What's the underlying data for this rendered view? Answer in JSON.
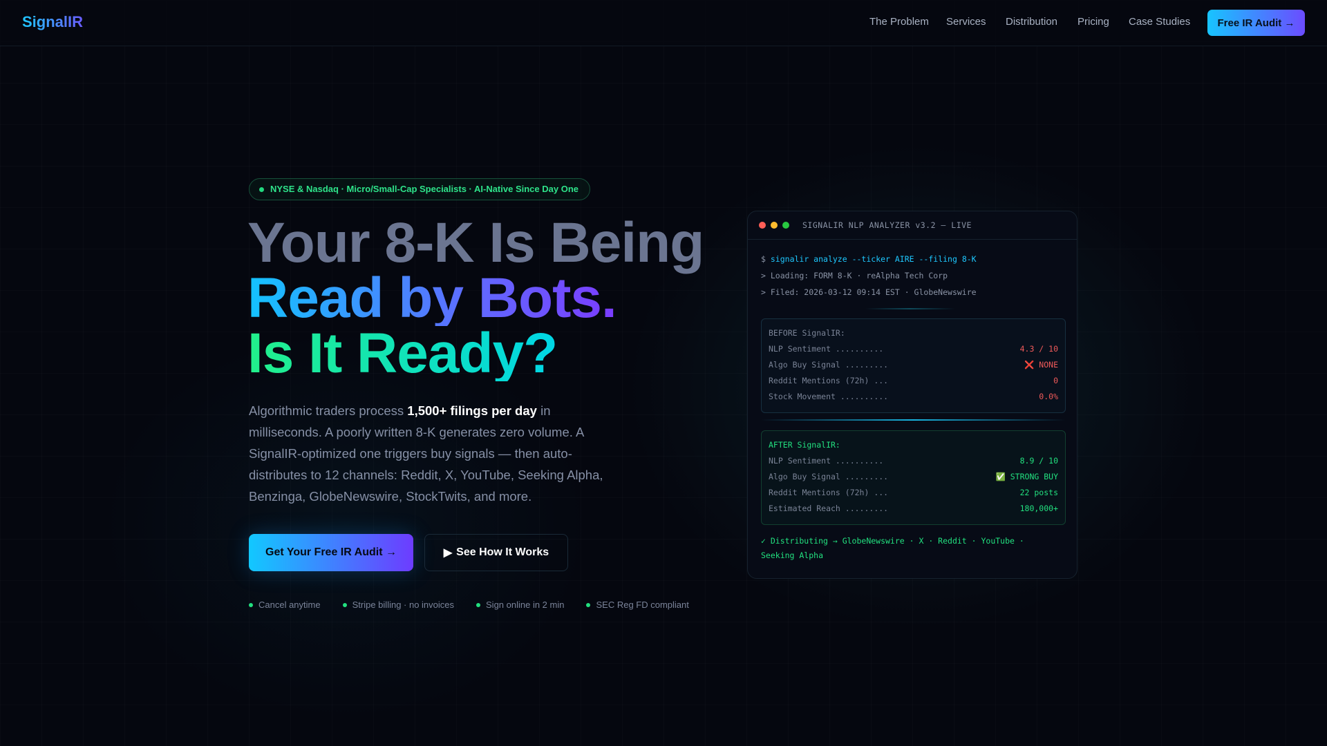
{
  "nav": {
    "logo": "SignalIR",
    "links": [
      "The Problem",
      "Services",
      "Distribution",
      "Pricing",
      "Case Studies"
    ],
    "cta": "Free IR Audit →"
  },
  "hero": {
    "badge": "NYSE & Nasdaq · Micro/Small-Cap Specialists · AI-Native Since Day One",
    "headline": [
      "Your 8-K Is Being",
      "Read by Bots.",
      "Is It Ready?"
    ],
    "para_pre": "Algorithmic traders process ",
    "para_bold": "1,500+ filings per day",
    "para_post": " in milliseconds. A poorly written 8-K generates zero volume. A SignalIR-optimized one triggers buy signals — then auto-distributes to 12 channels: Reddit, X, YouTube, Seeking Alpha, Benzinga, GlobeNewswire, StockTwits, and more.",
    "primary_cta": "Get Your Free IR Audit →",
    "secondary_cta": "See How It Works",
    "trust": [
      "Cancel anytime",
      "Stripe billing · no invoices",
      "Sign online in 2 min",
      "SEC Reg FD compliant"
    ]
  },
  "terminal": {
    "title": "SIGNALIR NLP ANALYZER v3.2 — LIVE",
    "prompt": "$",
    "command": "signalir analyze --ticker AIRE --filing 8-K",
    "lines": [
      "> Loading: FORM 8-K · reAlpha Tech Corp",
      "> Filed: 2026-03-12 09:14 EST · GlobeNewswire"
    ],
    "before": {
      "heading": "BEFORE SignalIR:",
      "rows": [
        {
          "label": "NLP Sentiment ..........",
          "value": "4.3 / 10"
        },
        {
          "label": "Algo Buy Signal .........",
          "value": "❌ NONE"
        },
        {
          "label": "Reddit Mentions (72h) ...",
          "value": "0"
        },
        {
          "label": "Stock Movement ..........",
          "value": "0.0%"
        }
      ]
    },
    "after": {
      "heading": "AFTER SignalIR:",
      "rows": [
        {
          "label": "NLP Sentiment ..........",
          "value": "8.9 / 10"
        },
        {
          "label": "Algo Buy Signal .........",
          "value": "✅ STRONG BUY"
        },
        {
          "label": "Reddit Mentions (72h) ...",
          "value": "22 posts"
        },
        {
          "label": "Estimated Reach .........",
          "value": "180,000+"
        }
      ]
    },
    "distribution": "✓ Distributing → GlobeNewswire · X · Reddit · YouTube · Seeking Alpha"
  },
  "colors": {
    "accent_cyan": "#1ec8ff",
    "accent_purple": "#6b4cff",
    "green": "#22e07f",
    "red": "#f05a5a"
  }
}
